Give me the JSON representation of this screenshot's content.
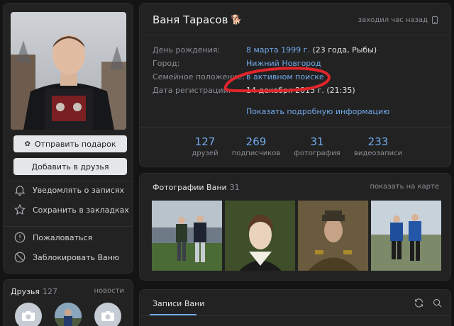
{
  "profile": {
    "name": "Ваня Тарасов",
    "name_emoji": "🐕",
    "last_seen": "заходил час назад",
    "info": {
      "birthday_label": "День рождения:",
      "birthday_date": "8 марта 1999 г.",
      "birthday_extra": "(23 года, Рыбы)",
      "city_label": "Город:",
      "city_value": "Нижний Новгород",
      "family_label": "Семейное положение:",
      "family_value": "в активном поиске",
      "reg_label": "Дата регистрации:",
      "reg_value": "14 декабря 2015 г. (21:35)"
    },
    "more_info": "Показать подробную информацию",
    "stats": [
      {
        "n": "127",
        "l": "друзей"
      },
      {
        "n": "269",
        "l": "подписчиков"
      },
      {
        "n": "31",
        "l": "фотография"
      },
      {
        "n": "233",
        "l": "видеозаписи"
      }
    ]
  },
  "left": {
    "gift_button": "Отправить подарок",
    "add_friend_button": "Добавить в друзья",
    "menu": {
      "notify": "Уведомлять о записях",
      "bookmark": "Сохранить в закладках",
      "report": "Пожаловаться",
      "block": "Заблокировать Ваню"
    }
  },
  "friends": {
    "title": "Друзья",
    "count": "127",
    "news": "новости"
  },
  "photos": {
    "title": "Фотографии Вани",
    "count": "31",
    "map_link": "показать на карте"
  },
  "posts": {
    "tab": "Записи Вани"
  },
  "colors": {
    "accent": "#71aaeb",
    "card": "#222222",
    "background": "#141414",
    "marker": "#e0252b"
  },
  "icons": [
    "gift-icon",
    "bell-icon",
    "star-icon",
    "warning-icon",
    "block-icon",
    "phone-icon",
    "refresh-icon",
    "search-icon",
    "camera-icon"
  ]
}
